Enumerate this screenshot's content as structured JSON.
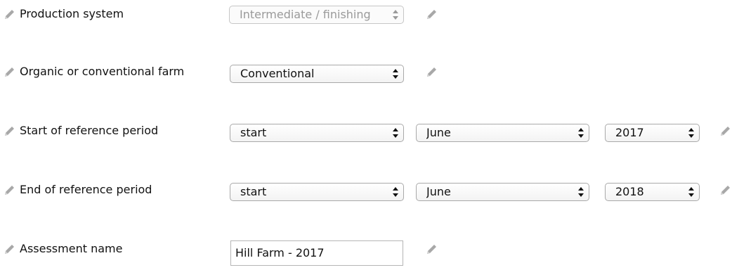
{
  "fields": {
    "production_system": {
      "label": "Production system",
      "value": "Intermediate / finishing",
      "disabled": true
    },
    "farm_type": {
      "label": "Organic or conventional farm",
      "value": "Conventional"
    },
    "start_period": {
      "label": "Start of reference period",
      "part": "start",
      "month": "June",
      "year": "2017"
    },
    "end_period": {
      "label": "End of reference period",
      "part": "start",
      "month": "June",
      "year": "2018"
    },
    "assessment_name": {
      "label": "Assessment name",
      "value": "Hill Farm - 2017"
    }
  },
  "icons": {
    "edit": "pencil-icon",
    "select_arrows": "updown-arrows-icon"
  },
  "colors": {
    "pencil": "#a8a8a8",
    "disabled_text": "#9a9a9a",
    "border": "#a9a9a9"
  }
}
